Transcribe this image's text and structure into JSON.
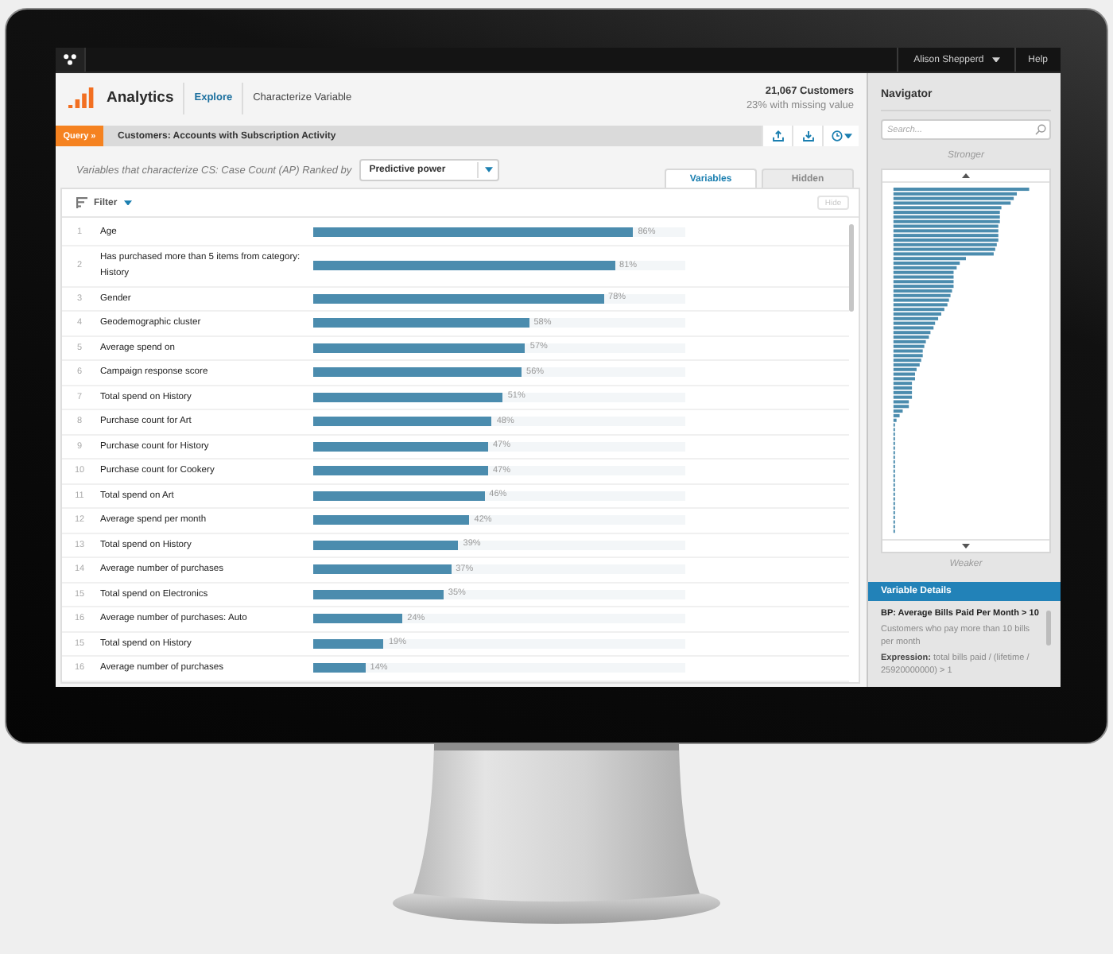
{
  "top_bar": {
    "user": "Alison Shepperd",
    "help": "Help"
  },
  "header": {
    "app_name": "Analytics",
    "breadcrumb": [
      {
        "label": "Explore",
        "kind": "link"
      },
      {
        "label": "Characterize Variable",
        "kind": "current"
      }
    ],
    "count": "21,067 Customers",
    "note": "23% with missing value"
  },
  "query_bar": {
    "button": "Query »",
    "title": "Customers: Accounts with Subscription Activity"
  },
  "ranking": {
    "label": "Variables that characterize CS: Case Count (AP) Ranked by",
    "dropdown": "Predictive power"
  },
  "tabs": [
    {
      "label": "Variables",
      "selected": true
    },
    {
      "label": "Hidden",
      "selected": false
    }
  ],
  "filter": {
    "label": "Filter",
    "hide_button": {
      "label": "Hide",
      "disabled": true
    }
  },
  "variables": [
    {
      "index": "1",
      "name": "Age",
      "level": 0.86,
      "value": "86%"
    },
    {
      "index": "2",
      "name": "Has purchased more than 5 items from category: History",
      "level": 0.81,
      "value": "81%"
    },
    {
      "index": "3",
      "name": "Gender",
      "level": 0.78,
      "value": "78%"
    },
    {
      "index": "4",
      "name": "Geodemographic cluster",
      "level": 0.58,
      "value": "58%"
    },
    {
      "index": "5",
      "name": "Average spend on",
      "level": 0.57,
      "value": "57%"
    },
    {
      "index": "6",
      "name": "Campaign response score",
      "level": 0.56,
      "value": "56%"
    },
    {
      "index": "7",
      "name": "Total spend on History",
      "level": 0.51,
      "value": "51%"
    },
    {
      "index": "8",
      "name": "Purchase count for Art",
      "level": 0.48,
      "value": "48%"
    },
    {
      "index": "9",
      "name": "Purchase count for History",
      "level": 0.47,
      "value": "47%"
    },
    {
      "index": "10",
      "name": "Purchase count for Cookery",
      "level": 0.47,
      "value": "47%"
    },
    {
      "index": "11",
      "name": "Total spend on Art",
      "level": 0.46,
      "value": "46%"
    },
    {
      "index": "12",
      "name": "Average spend per month",
      "level": 0.42,
      "value": "42%"
    },
    {
      "index": "13",
      "name": "Total spend on History",
      "level": 0.39,
      "value": "39%"
    },
    {
      "index": "14",
      "name": "Average number of purchases",
      "level": 0.37,
      "value": "37%"
    },
    {
      "index": "15",
      "name": "Total spend on Electronics",
      "level": 0.35,
      "value": "35%"
    },
    {
      "index": "16",
      "name": "Average number of purchases: Auto",
      "level": 0.24,
      "value": "24%"
    },
    {
      "index": "15",
      "name": "Total spend on History",
      "level": 0.19,
      "value": "19%"
    },
    {
      "index": "16",
      "name": "Average number of purchases",
      "level": 0.14,
      "value": "14%"
    }
  ],
  "navigator": {
    "title": "Navigator",
    "search": {
      "placeholder": "Search..."
    },
    "top_label": "Stronger",
    "bottom_label": "Weaker"
  },
  "variable_details": {
    "header": "Variable Details",
    "title": "BP: Average Bills Paid Per Month > 10",
    "description": "Customers who pay more than 10 bills per month",
    "expression": "**Expression:** total bills paid / (lifetime / 25920000000) > 1"
  }
}
